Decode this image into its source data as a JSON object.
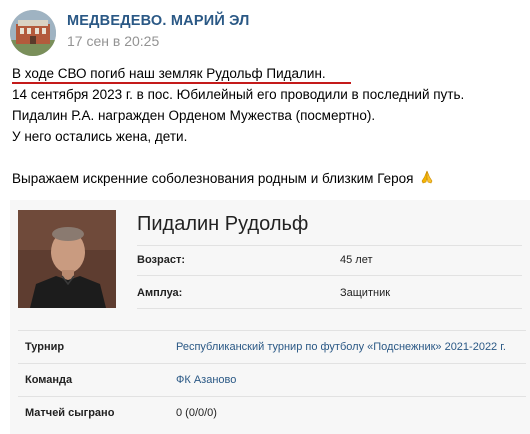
{
  "post": {
    "group_name": "МЕДВЕДЕВО. МАРИЙ ЭЛ",
    "time": "17 сен в 20:25",
    "lines": [
      "В ходе СВО погиб наш земляк Рудольф Пидалин.",
      "14 сентября 2023 г. в пос. Юбилейный его проводили в последний путь.",
      "Пидалин Р.А. награжден Орденом Мужества (посмертно).",
      "У него остались жена, дети."
    ],
    "condolence": "Выражаем искренние соболезнования родным и близким Героя",
    "emoji": "pray-emoji"
  },
  "player": {
    "name": "Пидалин Рудольф",
    "age_label": "Возраст:",
    "age_value": "45 лет",
    "role_label": "Амплуа:",
    "role_value": "Защитник",
    "stats": [
      {
        "label": "Турнир",
        "value": "Республиканский турнир по футболу «Подснежник» 2021-2022 г.",
        "link": true
      },
      {
        "label": "Команда",
        "value": "ФК Азаново",
        "link": true
      },
      {
        "label": "Матчей сыграно",
        "value": "0 (0/0/0)",
        "link": false
      }
    ]
  },
  "colors": {
    "link": "#2a5885",
    "underline": "#c41a1a",
    "card_bg": "#f7f7f7",
    "time": "#939393"
  }
}
